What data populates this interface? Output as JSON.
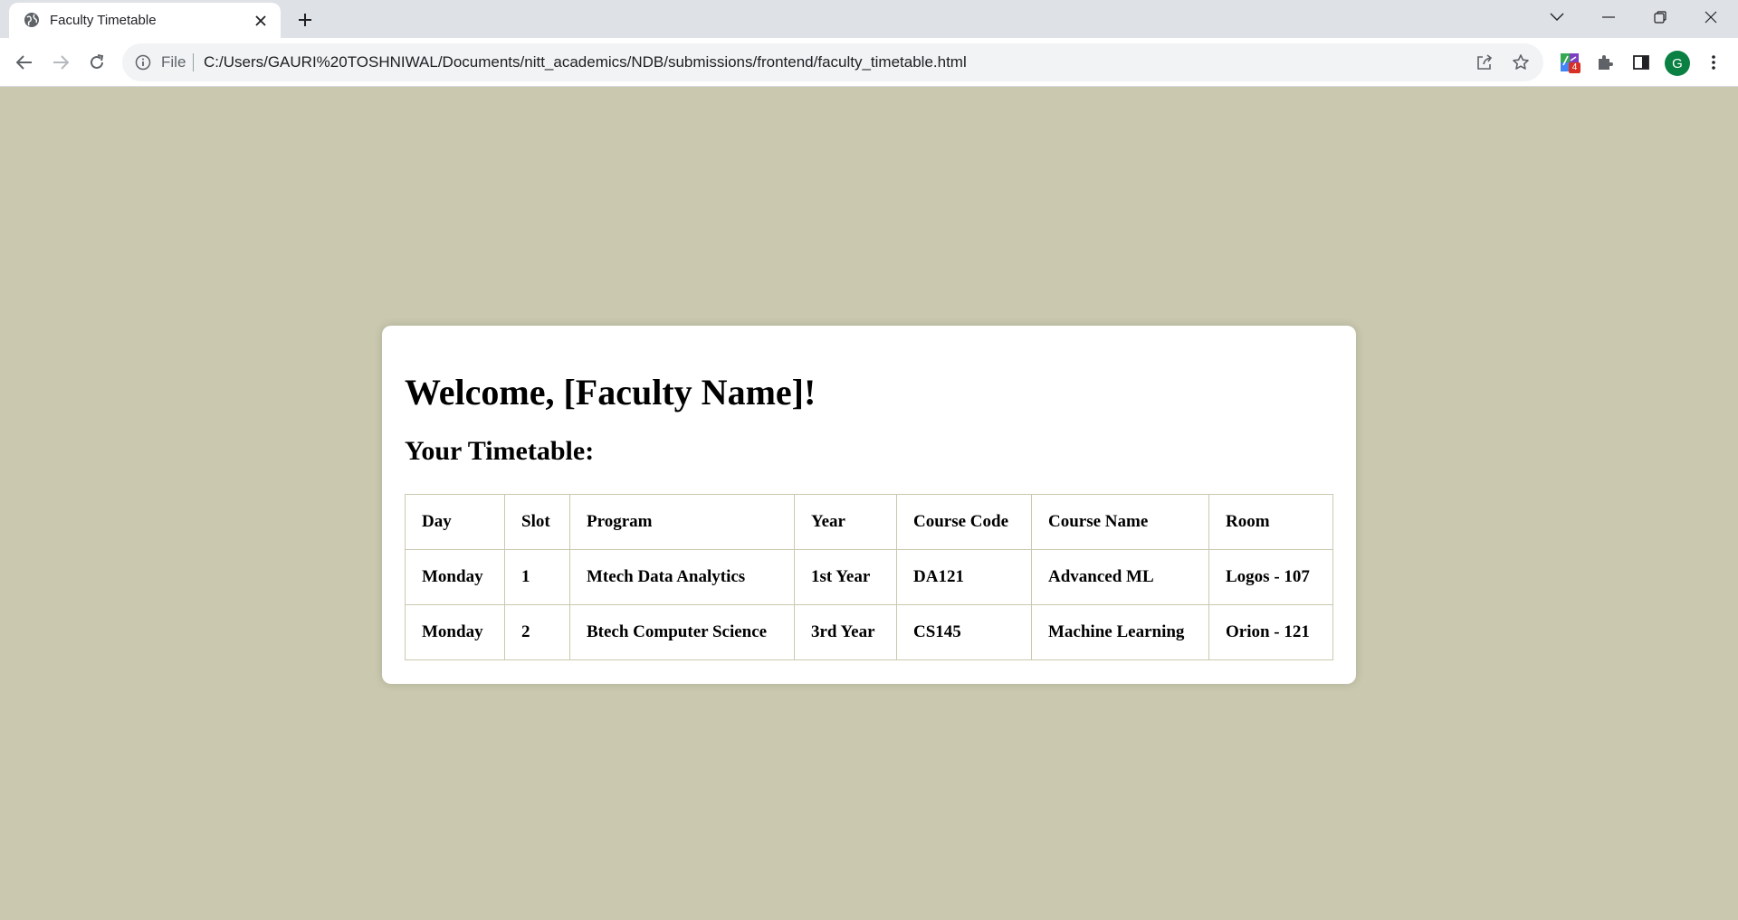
{
  "browser": {
    "tab_title": "Faculty Timetable",
    "omnibox": {
      "scheme_label": "File",
      "url": "C:/Users/GAURI%20TOSHNIWAL/Documents/nitt_academics/NDB/submissions/frontend/faculty_timetable.html"
    },
    "extension_badge": "4",
    "avatar_initial": "G",
    "icons": [
      "globe-icon",
      "close-icon",
      "plus-icon",
      "chevron-down-icon",
      "minimize-icon",
      "restore-icon",
      "window-close-icon",
      "back-arrow-icon",
      "forward-arrow-icon",
      "reload-icon",
      "info-icon",
      "share-icon",
      "star-icon",
      "extension-icon",
      "puzzle-icon",
      "side-panel-icon",
      "kebab-menu-icon"
    ]
  },
  "page": {
    "welcome_heading": "Welcome, [Faculty Name]!",
    "subtitle": "Your Timetable:",
    "colors": {
      "background": "#cac9af",
      "card": "#ffffff",
      "table_border": "#cac9af"
    },
    "table": {
      "headers": [
        "Day",
        "Slot",
        "Program",
        "Year",
        "Course Code",
        "Course Name",
        "Room"
      ],
      "rows": [
        [
          "Monday",
          "1",
          "Mtech Data Analytics",
          "1st Year",
          "DA121",
          "Advanced ML",
          "Logos - 107"
        ],
        [
          "Monday",
          "2",
          "Btech Computer Science",
          "3rd Year",
          "CS145",
          "Machine Learning",
          "Orion - 121"
        ]
      ]
    }
  }
}
